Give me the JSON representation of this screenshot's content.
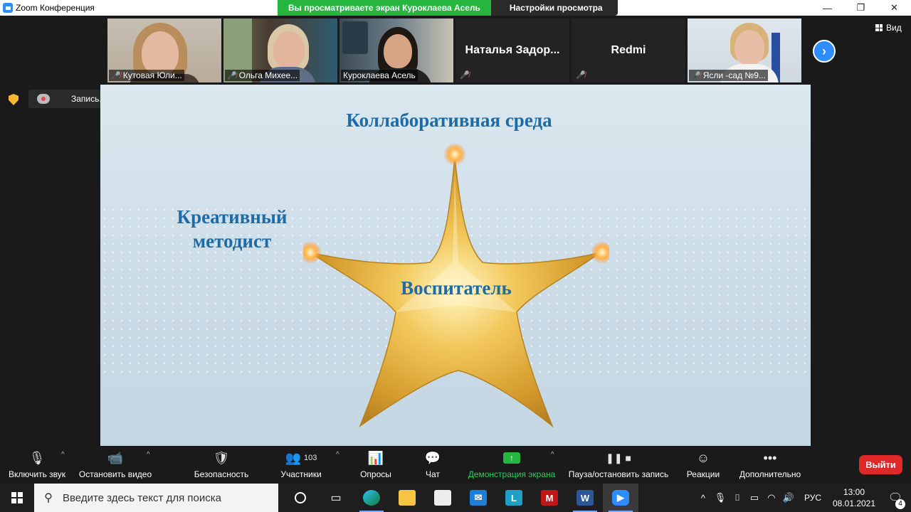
{
  "window": {
    "title": "Zoom Конференция",
    "minimize": "—",
    "maximize": "❐",
    "close": "✕"
  },
  "share_banner": {
    "viewing": "Вы просматриваете экран Куроклаева Асель",
    "options": "Настройки просмотра",
    "options_caret": "⌄"
  },
  "top_bar": {
    "view_label": "Вид",
    "next_arrow": "›"
  },
  "participants": [
    {
      "name": "Кутовая Юли...",
      "mic_muted": true
    },
    {
      "name": "Ольга Михее...",
      "mic_muted": true
    },
    {
      "name": "Куроклаева Асель",
      "mic_muted": false
    },
    {
      "name": "Наталья Задор...",
      "mic_muted": true
    },
    {
      "name": "Redmi",
      "mic_muted": true
    },
    {
      "name": "Ясли -сад №9...",
      "mic_muted": true
    }
  ],
  "recording": {
    "label": "Запись..."
  },
  "slide": {
    "top_text": "Коллаборативная среда",
    "left_text": "Креативный методист",
    "center_text": "Воспитатель"
  },
  "toolbar": {
    "unmute": "Включить звук",
    "stop_video": "Остановить видео",
    "security": "Безопасность",
    "participants": "Участники",
    "participants_count": "103",
    "polls": "Опросы",
    "chat": "Чат",
    "share_screen": "Демонстрация экрана",
    "pause_record": "Пауза/остановить запись",
    "reactions": "Реакции",
    "more": "Дополнительно",
    "leave": "Выйти"
  },
  "taskbar": {
    "search_placeholder": "Введите здесь текст для поиска",
    "lang": "РУС",
    "time": "13:00",
    "date": "08.01.2021",
    "notifications": "4"
  },
  "colors": {
    "zoom_blue": "#2d8cff",
    "share_green": "#26b53f",
    "leave_red": "#e02828",
    "slide_text": "#1f6ba6",
    "slide_bg": "#cfe0ea"
  }
}
